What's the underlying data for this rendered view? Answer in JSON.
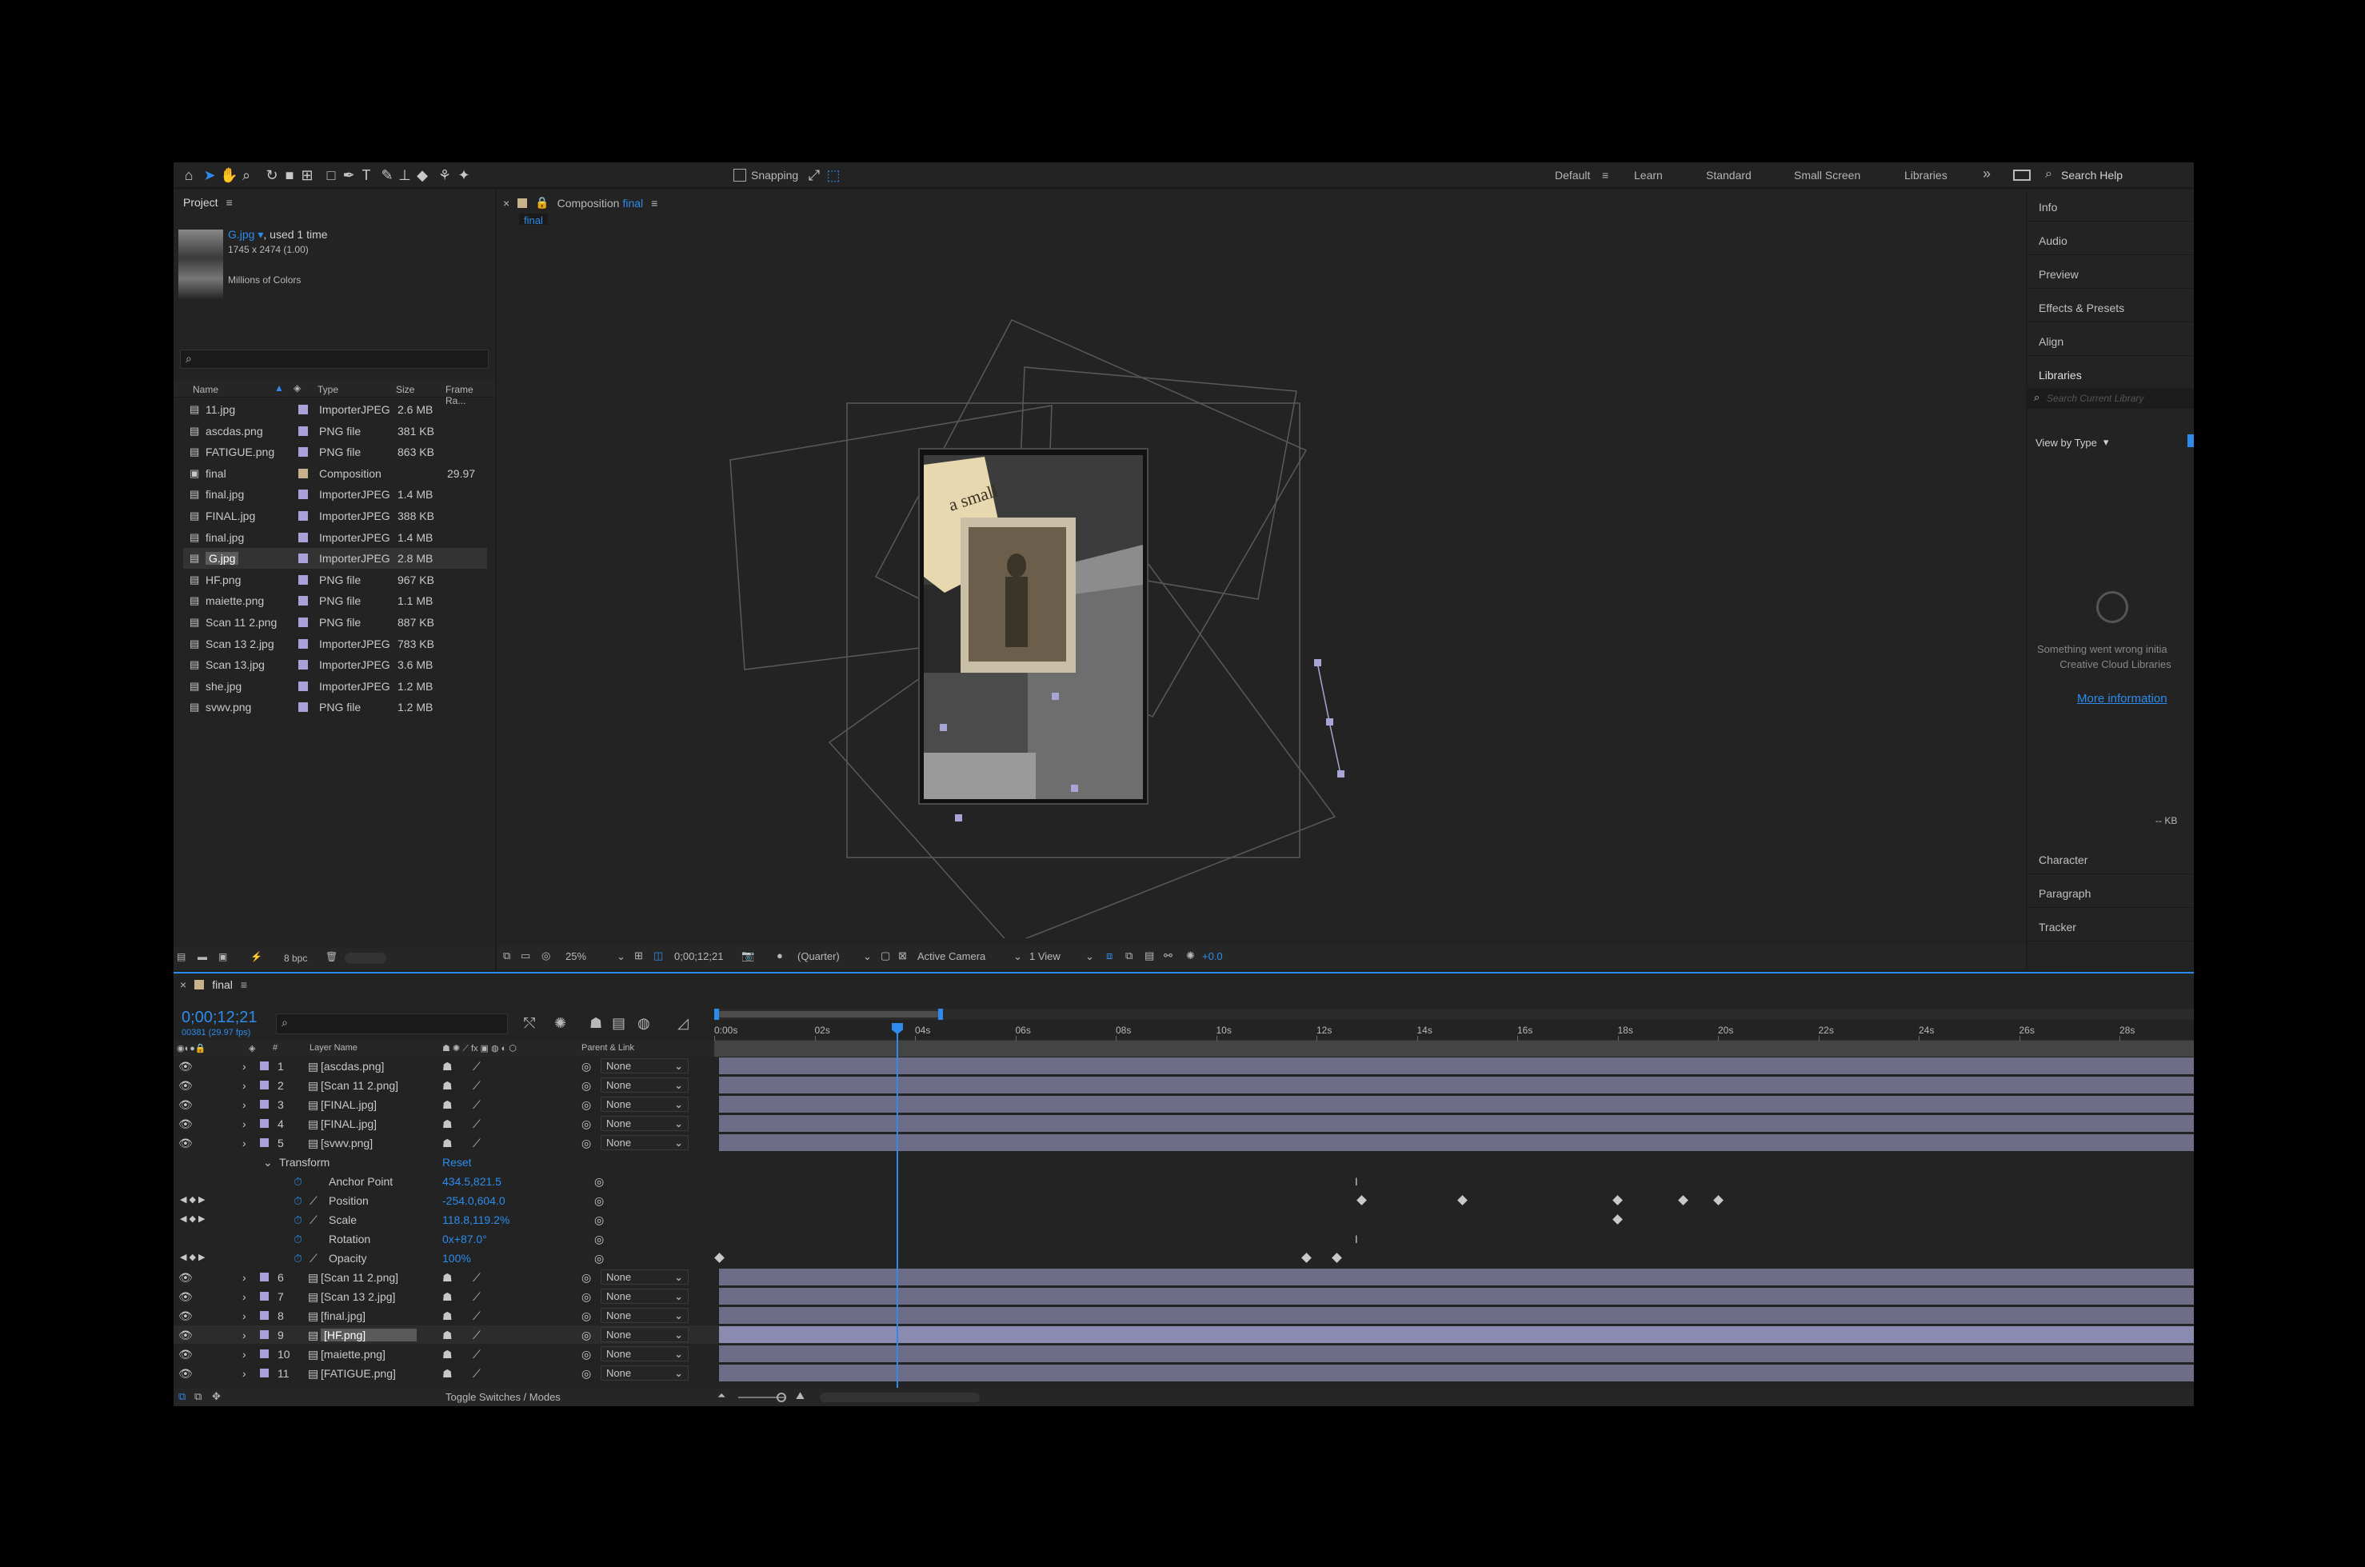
{
  "toolbar": {
    "snapping_label": "Snapping",
    "workspaces": [
      "Default",
      "Learn",
      "Standard",
      "Small Screen",
      "Libraries"
    ],
    "more": "»",
    "search_help": "Search Help"
  },
  "project": {
    "tab": "Project",
    "item_name": "G.jpg ▾",
    "used": ", used 1 time",
    "dims": "1745 x 2474 (1.00)",
    "colors": "Millions of Colors",
    "search_placeholder": "",
    "columns": [
      "Name",
      "Type",
      "Size",
      "Frame Ra..."
    ],
    "items": [
      {
        "name": "11.jpg",
        "type": "ImporterJPEG",
        "size": "2.6 MB",
        "fr": "",
        "color": "#a9a2d8"
      },
      {
        "name": "ascdas.png",
        "type": "PNG file",
        "size": "381 KB",
        "fr": "",
        "color": "#a9a2d8"
      },
      {
        "name": "FATIGUE.png",
        "type": "PNG file",
        "size": "863 KB",
        "fr": "",
        "color": "#a9a2d8"
      },
      {
        "name": "final",
        "type": "Composition",
        "size": "",
        "fr": "29.97",
        "color": "#c8b28c"
      },
      {
        "name": "final.jpg",
        "type": "ImporterJPEG",
        "size": "1.4 MB",
        "fr": "",
        "color": "#a9a2d8"
      },
      {
        "name": "FINAL.jpg",
        "type": "ImporterJPEG",
        "size": "388 KB",
        "fr": "",
        "color": "#a9a2d8"
      },
      {
        "name": "final.jpg",
        "type": "ImporterJPEG",
        "size": "1.4 MB",
        "fr": "",
        "color": "#a9a2d8"
      },
      {
        "name": "G.jpg",
        "type": "ImporterJPEG",
        "size": "2.8 MB",
        "fr": "",
        "color": "#a9a2d8"
      },
      {
        "name": "HF.png",
        "type": "PNG file",
        "size": "967 KB",
        "fr": "",
        "color": "#a9a2d8"
      },
      {
        "name": "maiette.png",
        "type": "PNG file",
        "size": "1.1 MB",
        "fr": "",
        "color": "#a9a2d8"
      },
      {
        "name": "Scan 11 2.png",
        "type": "PNG file",
        "size": "887 KB",
        "fr": "",
        "color": "#a9a2d8"
      },
      {
        "name": "Scan 13 2.jpg",
        "type": "ImporterJPEG",
        "size": "783 KB",
        "fr": "",
        "color": "#a9a2d8"
      },
      {
        "name": "Scan 13.jpg",
        "type": "ImporterJPEG",
        "size": "3.6 MB",
        "fr": "",
        "color": "#a9a2d8"
      },
      {
        "name": "she.jpg",
        "type": "ImporterJPEG",
        "size": "1.2 MB",
        "fr": "",
        "color": "#a9a2d8"
      },
      {
        "name": "svwv.png",
        "type": "PNG file",
        "size": "1.2 MB",
        "fr": "",
        "color": "#a9a2d8"
      }
    ],
    "bpc": "8 bpc"
  },
  "composition": {
    "tab_prefix": "Composition",
    "tab_name": "final",
    "breadcrumb": "final",
    "footer": {
      "zoom": "25%",
      "timecode": "0;00;12;21",
      "resolution": "(Quarter)",
      "camera": "Active Camera",
      "views": "1 View",
      "exposure": "+0.0"
    },
    "photo_text": "a small"
  },
  "right_panel": {
    "items": [
      "Info",
      "Audio",
      "Preview",
      "Effects & Presets",
      "Align",
      "Libraries"
    ],
    "search_placeholder": "Search Current Library",
    "view_by": "View by Type",
    "error_line1": "Something went wrong initia",
    "error_line2": "Creative Cloud Libraries",
    "more_info": "More information",
    "kb": "-- KB",
    "bottom_items": [
      "Character",
      "Paragraph",
      "Tracker"
    ]
  },
  "timeline": {
    "tab": "final",
    "timecode": "0;00;12;21",
    "fps": "00381 (29.97 fps)",
    "col_hash": "#",
    "col_layer": "Layer Name",
    "col_parent": "Parent & Link",
    "ruler": [
      "0:00s",
      "02s",
      "04s",
      "06s",
      "08s",
      "10s",
      "12s",
      "14s",
      "16s",
      "18s",
      "20s",
      "22s",
      "24s",
      "26s",
      "28s"
    ],
    "layers_top": [
      {
        "num": "1",
        "name": "[ascdas.png]",
        "parent": "None"
      },
      {
        "num": "2",
        "name": "[Scan 11 2.png]",
        "parent": "None"
      },
      {
        "num": "3",
        "name": "[FINAL.jpg]",
        "parent": "None"
      },
      {
        "num": "4",
        "name": "[FINAL.jpg]",
        "parent": "None"
      },
      {
        "num": "5",
        "name": "[svwv.png]",
        "parent": "None"
      }
    ],
    "transform": {
      "label": "Transform",
      "reset": "Reset",
      "props": [
        {
          "name": "Anchor Point",
          "value": "434.5,821.5"
        },
        {
          "name": "Position",
          "value": "-254.0,604.0"
        },
        {
          "name": "Scale",
          "value": "118.8,119.2%"
        },
        {
          "name": "Rotation",
          "value": "0x+87.0°"
        },
        {
          "name": "Opacity",
          "value": "100%"
        }
      ]
    },
    "layers_bottom": [
      {
        "num": "6",
        "name": "[Scan 11 2.png]",
        "parent": "None"
      },
      {
        "num": "7",
        "name": "[Scan 13 2.jpg]",
        "parent": "None"
      },
      {
        "num": "8",
        "name": "[final.jpg]",
        "parent": "None"
      },
      {
        "num": "9",
        "name": "[HF.png]",
        "parent": "None"
      },
      {
        "num": "10",
        "name": "[maiette.png]",
        "parent": "None"
      },
      {
        "num": "11",
        "name": "[FATIGUE.png]",
        "parent": "None"
      }
    ],
    "toggle": "Toggle Switches / Modes"
  },
  "colors": {
    "accent": "#2d8ceb",
    "layer_bar": "#6e6d88",
    "label": "#a9a2d8"
  }
}
